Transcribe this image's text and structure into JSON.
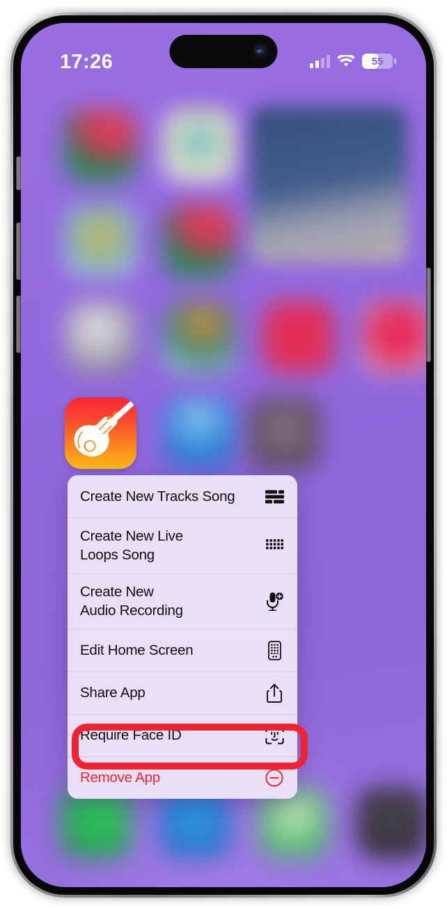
{
  "status_bar": {
    "time": "17:26",
    "battery_percent": "55",
    "battery_level": 55,
    "cellular_icon": "cellular-signal-icon",
    "wifi_icon": "wifi-icon",
    "battery_icon": "battery-icon"
  },
  "home_screen": {
    "app_icon_name": "GarageBand",
    "app_icon_glyph": "guitar-icon",
    "wallpaper_color": "#9168dd"
  },
  "context_menu": {
    "items": [
      {
        "label": "Create New Tracks Song",
        "icon": "tracks-icon",
        "destructive": false
      },
      {
        "label": "Create New Live\nLoops Song",
        "icon": "live-loops-grid-icon",
        "destructive": false
      },
      {
        "label": "Create New\nAudio Recording",
        "icon": "microphone-plus-icon",
        "destructive": false
      },
      {
        "label": "Edit Home Screen",
        "icon": "edit-home-screen-icon",
        "destructive": false
      },
      {
        "label": "Share App",
        "icon": "share-icon",
        "destructive": false
      },
      {
        "label": "Require Face ID",
        "icon": "face-id-icon",
        "destructive": false
      },
      {
        "label": "Remove App",
        "icon": "remove-circle-icon",
        "destructive": true
      }
    ]
  },
  "annotation": {
    "highlight_target": "Require Face ID",
    "highlight_color": "#ef2331"
  },
  "colors": {
    "menu_background": "#e9e0f8",
    "menu_text": "#0f0f10",
    "destructive_text": "#f5222d",
    "wallpaper": "#9168dd",
    "highlight": "#ef2331"
  }
}
